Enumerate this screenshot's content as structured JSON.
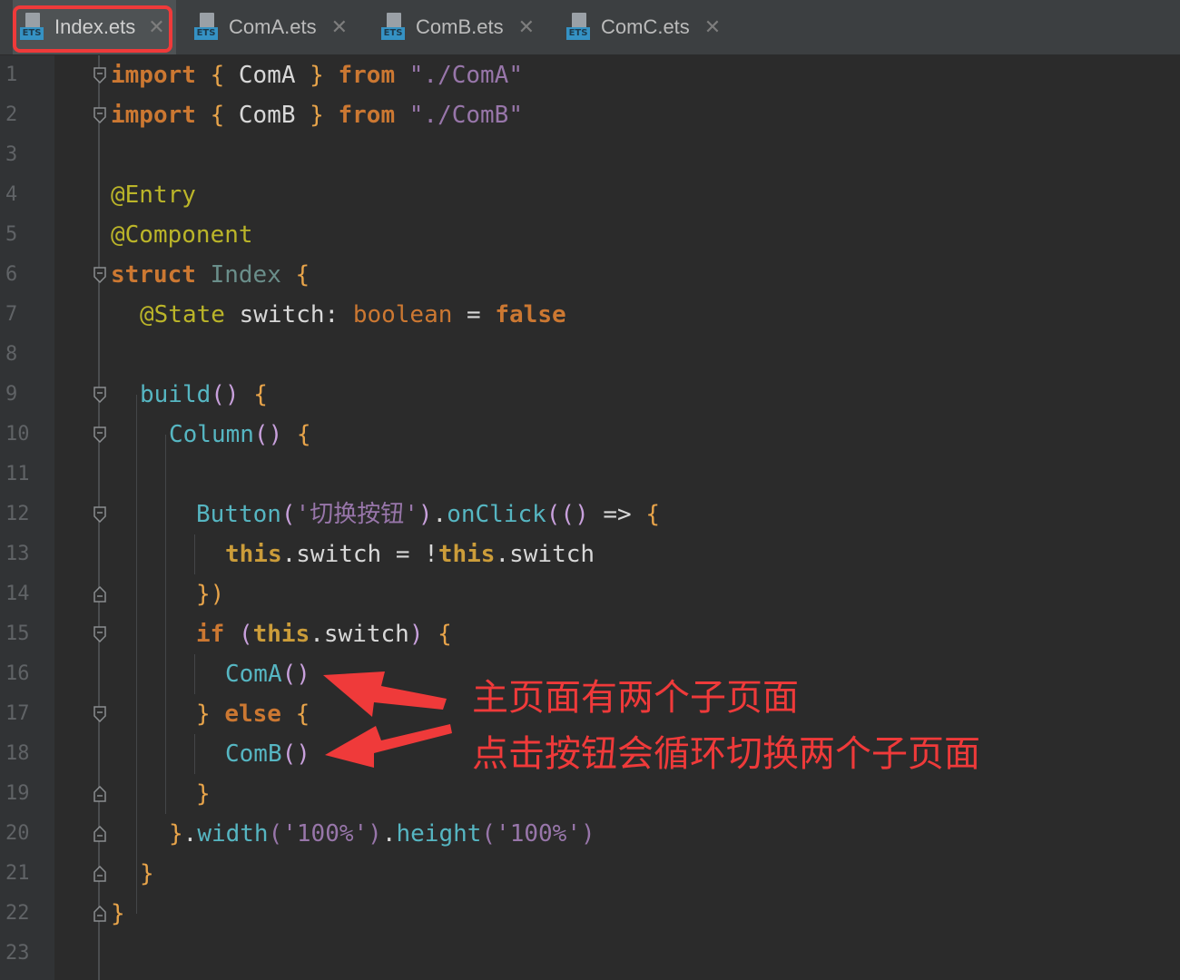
{
  "tabs": [
    {
      "label": "Index.ets",
      "icon": "ets-file-icon",
      "active": true
    },
    {
      "label": "ComA.ets",
      "icon": "ets-file-icon",
      "active": false
    },
    {
      "label": "ComB.ets",
      "icon": "ets-file-icon",
      "active": false
    },
    {
      "label": "ComC.ets",
      "icon": "ets-file-icon",
      "active": false
    }
  ],
  "file_badge": "ETS",
  "close_glyph": "✕",
  "line_numbers": [
    "1",
    "2",
    "3",
    "4",
    "5",
    "6",
    "7",
    "8",
    "9",
    "10",
    "11",
    "12",
    "13",
    "14",
    "15",
    "16",
    "17",
    "18",
    "19",
    "20",
    "21",
    "22",
    "23"
  ],
  "code": {
    "l1": {
      "import": "import",
      "ob": "{",
      "name": "ComA",
      "cb": "}",
      "from": "from",
      "path": "\"./ComA\""
    },
    "l2": {
      "import": "import",
      "ob": "{",
      "name": "ComB",
      "cb": "}",
      "from": "from",
      "path": "\"./ComB\""
    },
    "l4": "@Entry",
    "l5": "@Component",
    "l6": {
      "struct": "struct",
      "name": "Index",
      "ob": "{"
    },
    "l7": {
      "ann": "@State",
      "var": "switch",
      "colon": ":",
      "type": "boolean",
      "eq": "=",
      "val": "false"
    },
    "l9": {
      "fn": "build",
      "parens": "()",
      "ob": "{"
    },
    "l10": {
      "fn": "Column",
      "parens": "()",
      "ob": "{"
    },
    "l12": {
      "fn": "Button",
      "op": "(",
      "arg": "'切换按钮'",
      "cp": ")",
      "dot": ".",
      "method": "onClick",
      "arrow_open": "((",
      "arrow_close": ")",
      "arrow": "=>",
      "ob": "{"
    },
    "l13": {
      "this1": "this",
      "prop1": ".switch",
      "eq": "=",
      "bang": "!",
      "this2": "this",
      "prop2": ".switch"
    },
    "l14": "})",
    "l15": {
      "kw": "if",
      "op": "(",
      "this": "this",
      "prop": ".switch",
      "cp": ")",
      "ob": "{"
    },
    "l16": {
      "fn": "ComA",
      "parens": "()"
    },
    "l17": {
      "cb": "}",
      "kw": "else",
      "ob": "{"
    },
    "l18": {
      "fn": "ComB",
      "parens": "()"
    },
    "l19": "}",
    "l20": {
      "cb": "}",
      "dot1": ".",
      "m1": "width",
      "a1": "('100%')",
      "dot2": ".",
      "m2": "height",
      "a2": "('100%')"
    },
    "l21": "}",
    "l22": "}"
  },
  "annotations": {
    "line1": "主页面有两个子页面",
    "line2": "点击按钮会循环切换两个子页面",
    "color": "#ef3a3a"
  },
  "colors": {
    "editor_bg": "#2b2b2b",
    "gutter_bg": "#313335",
    "tabbar_bg": "#3c3f41",
    "highlight": "#ef3a3a"
  }
}
